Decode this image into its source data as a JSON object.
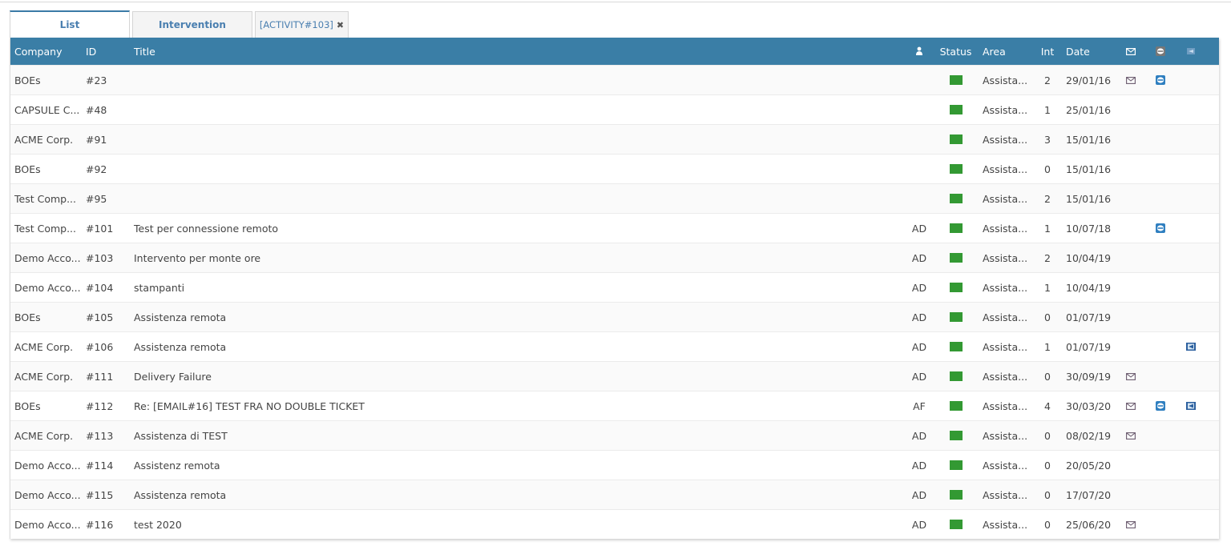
{
  "tabs": [
    {
      "label": "List",
      "active": true
    },
    {
      "label": "Intervention",
      "active": false
    },
    {
      "label": "[ACTIVITY#103]",
      "active": false,
      "closable": true,
      "close_glyph": "✖"
    }
  ],
  "table": {
    "columns": {
      "company": "Company",
      "id": "ID",
      "title": "Title",
      "user_icon": "user-icon",
      "status": "Status",
      "area": "Area",
      "int": "Int",
      "date": "Date",
      "mail_icon": "mail-icon",
      "teamviewer_icon": "remote-session-icon",
      "rdp_icon": "remote-desktop-icon"
    },
    "status_color": "#339933",
    "header_color": "#3a7ea6",
    "rows": [
      {
        "company": "BOEs",
        "id": "#23",
        "title": "",
        "user": "",
        "area": "Assista...",
        "int": "2",
        "date": "29/01/16",
        "mail": true,
        "tv": true,
        "rdp": false
      },
      {
        "company": "CAPSULE C...",
        "id": "#48",
        "title": "",
        "user": "",
        "area": "Assista...",
        "int": "1",
        "date": "25/01/16",
        "mail": false,
        "tv": false,
        "rdp": false
      },
      {
        "company": "ACME Corp.",
        "id": "#91",
        "title": "",
        "user": "",
        "area": "Assista...",
        "int": "3",
        "date": "15/01/16",
        "mail": false,
        "tv": false,
        "rdp": false
      },
      {
        "company": "BOEs",
        "id": "#92",
        "title": "",
        "user": "",
        "area": "Assista...",
        "int": "0",
        "date": "15/01/16",
        "mail": false,
        "tv": false,
        "rdp": false
      },
      {
        "company": "Test Comp...",
        "id": "#95",
        "title": "",
        "user": "",
        "area": "Assista...",
        "int": "2",
        "date": "15/01/16",
        "mail": false,
        "tv": false,
        "rdp": false
      },
      {
        "company": "Test Comp...",
        "id": "#101",
        "title": "Test per connessione remoto",
        "user": "AD",
        "area": "Assista...",
        "int": "1",
        "date": "10/07/18",
        "mail": false,
        "tv": true,
        "rdp": false
      },
      {
        "company": "Demo Acco...",
        "id": "#103",
        "title": "Intervento per monte ore",
        "user": "AD",
        "area": "Assista...",
        "int": "2",
        "date": "10/04/19",
        "mail": false,
        "tv": false,
        "rdp": false
      },
      {
        "company": "Demo Acco...",
        "id": "#104",
        "title": "stampanti",
        "user": "AD",
        "area": "Assista...",
        "int": "1",
        "date": "10/04/19",
        "mail": false,
        "tv": false,
        "rdp": false
      },
      {
        "company": "BOEs",
        "id": "#105",
        "title": "Assistenza remota",
        "user": "AD",
        "area": "Assista...",
        "int": "0",
        "date": "01/07/19",
        "mail": false,
        "tv": false,
        "rdp": false
      },
      {
        "company": "ACME Corp.",
        "id": "#106",
        "title": "Assistenza remota",
        "user": "AD",
        "area": "Assista...",
        "int": "1",
        "date": "01/07/19",
        "mail": false,
        "tv": false,
        "rdp": true
      },
      {
        "company": "ACME Corp.",
        "id": "#111",
        "title": "Delivery Failure",
        "user": "AD",
        "area": "Assista...",
        "int": "0",
        "date": "30/09/19",
        "mail": true,
        "tv": false,
        "rdp": false
      },
      {
        "company": "BOEs",
        "id": "#112",
        "title": "Re: [EMAIL#16] TEST FRA NO DOUBLE TICKET",
        "user": "AF",
        "area": "Assista...",
        "int": "4",
        "date": "30/03/20",
        "mail": true,
        "tv": true,
        "rdp": true
      },
      {
        "company": "ACME Corp.",
        "id": "#113",
        "title": "Assistenza di TEST",
        "user": "AD",
        "area": "Assista...",
        "int": "0",
        "date": "08/02/19",
        "mail": true,
        "tv": false,
        "rdp": false
      },
      {
        "company": "Demo Acco...",
        "id": "#114",
        "title": "Assistenz remota",
        "user": "AD",
        "area": "Assista...",
        "int": "0",
        "date": "20/05/20",
        "mail": false,
        "tv": false,
        "rdp": false
      },
      {
        "company": "Demo Acco...",
        "id": "#115",
        "title": "Assistenza remota",
        "user": "AD",
        "area": "Assista...",
        "int": "0",
        "date": "17/07/20",
        "mail": false,
        "tv": false,
        "rdp": false
      },
      {
        "company": "Demo Acco...",
        "id": "#116",
        "title": "test 2020",
        "user": "AD",
        "area": "Assista...",
        "int": "0",
        "date": "25/06/20",
        "mail": true,
        "tv": false,
        "rdp": false
      }
    ]
  }
}
